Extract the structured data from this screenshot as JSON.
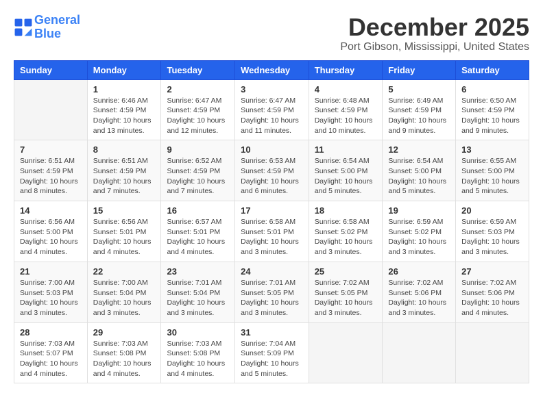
{
  "logo": {
    "line1": "General",
    "line2": "Blue"
  },
  "header": {
    "month": "December 2025",
    "location": "Port Gibson, Mississippi, United States"
  },
  "weekdays": [
    "Sunday",
    "Monday",
    "Tuesday",
    "Wednesday",
    "Thursday",
    "Friday",
    "Saturday"
  ],
  "weeks": [
    [
      {
        "day": "",
        "empty": true
      },
      {
        "day": "1",
        "sunrise": "6:46 AM",
        "sunset": "4:59 PM",
        "daylight": "10 hours and 13 minutes."
      },
      {
        "day": "2",
        "sunrise": "6:47 AM",
        "sunset": "4:59 PM",
        "daylight": "10 hours and 12 minutes."
      },
      {
        "day": "3",
        "sunrise": "6:47 AM",
        "sunset": "4:59 PM",
        "daylight": "10 hours and 11 minutes."
      },
      {
        "day": "4",
        "sunrise": "6:48 AM",
        "sunset": "4:59 PM",
        "daylight": "10 hours and 10 minutes."
      },
      {
        "day": "5",
        "sunrise": "6:49 AM",
        "sunset": "4:59 PM",
        "daylight": "10 hours and 9 minutes."
      },
      {
        "day": "6",
        "sunrise": "6:50 AM",
        "sunset": "4:59 PM",
        "daylight": "10 hours and 9 minutes."
      }
    ],
    [
      {
        "day": "7",
        "sunrise": "6:51 AM",
        "sunset": "4:59 PM",
        "daylight": "10 hours and 8 minutes."
      },
      {
        "day": "8",
        "sunrise": "6:51 AM",
        "sunset": "4:59 PM",
        "daylight": "10 hours and 7 minutes."
      },
      {
        "day": "9",
        "sunrise": "6:52 AM",
        "sunset": "4:59 PM",
        "daylight": "10 hours and 7 minutes."
      },
      {
        "day": "10",
        "sunrise": "6:53 AM",
        "sunset": "4:59 PM",
        "daylight": "10 hours and 6 minutes."
      },
      {
        "day": "11",
        "sunrise": "6:54 AM",
        "sunset": "5:00 PM",
        "daylight": "10 hours and 5 minutes."
      },
      {
        "day": "12",
        "sunrise": "6:54 AM",
        "sunset": "5:00 PM",
        "daylight": "10 hours and 5 minutes."
      },
      {
        "day": "13",
        "sunrise": "6:55 AM",
        "sunset": "5:00 PM",
        "daylight": "10 hours and 5 minutes."
      }
    ],
    [
      {
        "day": "14",
        "sunrise": "6:56 AM",
        "sunset": "5:00 PM",
        "daylight": "10 hours and 4 minutes."
      },
      {
        "day": "15",
        "sunrise": "6:56 AM",
        "sunset": "5:01 PM",
        "daylight": "10 hours and 4 minutes."
      },
      {
        "day": "16",
        "sunrise": "6:57 AM",
        "sunset": "5:01 PM",
        "daylight": "10 hours and 4 minutes."
      },
      {
        "day": "17",
        "sunrise": "6:58 AM",
        "sunset": "5:01 PM",
        "daylight": "10 hours and 3 minutes."
      },
      {
        "day": "18",
        "sunrise": "6:58 AM",
        "sunset": "5:02 PM",
        "daylight": "10 hours and 3 minutes."
      },
      {
        "day": "19",
        "sunrise": "6:59 AM",
        "sunset": "5:02 PM",
        "daylight": "10 hours and 3 minutes."
      },
      {
        "day": "20",
        "sunrise": "6:59 AM",
        "sunset": "5:03 PM",
        "daylight": "10 hours and 3 minutes."
      }
    ],
    [
      {
        "day": "21",
        "sunrise": "7:00 AM",
        "sunset": "5:03 PM",
        "daylight": "10 hours and 3 minutes."
      },
      {
        "day": "22",
        "sunrise": "7:00 AM",
        "sunset": "5:04 PM",
        "daylight": "10 hours and 3 minutes."
      },
      {
        "day": "23",
        "sunrise": "7:01 AM",
        "sunset": "5:04 PM",
        "daylight": "10 hours and 3 minutes."
      },
      {
        "day": "24",
        "sunrise": "7:01 AM",
        "sunset": "5:05 PM",
        "daylight": "10 hours and 3 minutes."
      },
      {
        "day": "25",
        "sunrise": "7:02 AM",
        "sunset": "5:05 PM",
        "daylight": "10 hours and 3 minutes."
      },
      {
        "day": "26",
        "sunrise": "7:02 AM",
        "sunset": "5:06 PM",
        "daylight": "10 hours and 3 minutes."
      },
      {
        "day": "27",
        "sunrise": "7:02 AM",
        "sunset": "5:06 PM",
        "daylight": "10 hours and 4 minutes."
      }
    ],
    [
      {
        "day": "28",
        "sunrise": "7:03 AM",
        "sunset": "5:07 PM",
        "daylight": "10 hours and 4 minutes."
      },
      {
        "day": "29",
        "sunrise": "7:03 AM",
        "sunset": "5:08 PM",
        "daylight": "10 hours and 4 minutes."
      },
      {
        "day": "30",
        "sunrise": "7:03 AM",
        "sunset": "5:08 PM",
        "daylight": "10 hours and 4 minutes."
      },
      {
        "day": "31",
        "sunrise": "7:04 AM",
        "sunset": "5:09 PM",
        "daylight": "10 hours and 5 minutes."
      },
      {
        "day": "",
        "empty": true
      },
      {
        "day": "",
        "empty": true
      },
      {
        "day": "",
        "empty": true
      }
    ]
  ],
  "labels": {
    "sunrise_prefix": "Sunrise: ",
    "sunset_prefix": "Sunset: ",
    "daylight_prefix": "Daylight: "
  }
}
